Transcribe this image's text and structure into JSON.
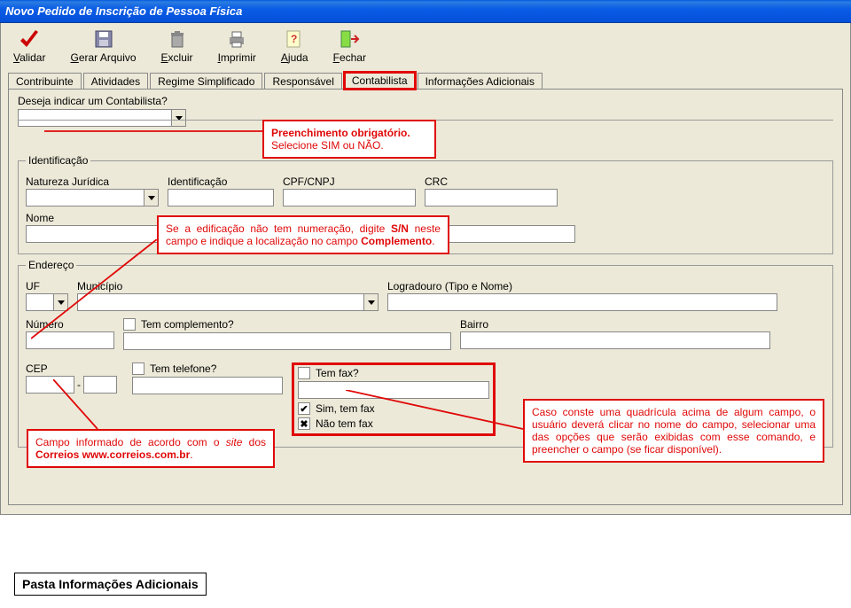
{
  "window": {
    "title": "Novo Pedido de Inscrição de Pessoa Física"
  },
  "toolbar": {
    "validar": "Validar",
    "gerar": "Gerar Arquivo",
    "excluir": "Excluir",
    "imprimir": "Imprimir",
    "ajuda": "Ajuda",
    "fechar": "Fechar"
  },
  "tabs": {
    "contribuinte": "Contribuinte",
    "atividades": "Atividades",
    "regime": "Regime Simplificado",
    "responsavel": "Responsável",
    "contabilista": "Contabilista",
    "infoadic": "Informações Adicionais"
  },
  "panel": {
    "desejalbl": "Deseja indicar um Contabilista?",
    "ident_legend": "Identificação",
    "nat_jur": "Natureza Jurídica",
    "ident": "Identificação",
    "cpfcnpj": "CPF/CNPJ",
    "crc": "CRC",
    "nome": "Nome",
    "end_legend": "Endereço",
    "uf": "UF",
    "municipio": "Município",
    "logradouro": "Logradouro (Tipo e Nome)",
    "numero": "Número",
    "temcomp": "Tem complemento?",
    "bairro": "Bairro",
    "cep": "CEP",
    "cepdash": "-",
    "temtel": "Tem telefone?",
    "temfax": "Tem fax?",
    "simfax": "Sim, tem fax",
    "naofax": "Não tem fax"
  },
  "callouts": {
    "c1": {
      "l1": "Preenchimento obrigatório.",
      "l2": "Selecione SIM ou NÃO."
    },
    "c2": {
      "pre": "Se a edificação não tem numeração, digite ",
      "bold": "S/N",
      "mid": " neste campo e indique a localização no campo ",
      "bold2": "Complemento",
      "end": "."
    },
    "c3": {
      "pre": "Campo informado de acordo com o ",
      "it": "site",
      "mid": " dos ",
      "b1": "Correios www.correios.com.br",
      "end": "."
    },
    "c4": "Caso conste uma quadrícula acima de algum campo, o usuário deverá clicar no nome do campo, selecionar uma das opções que serão exibidas com esse comando, e preencher o campo (se ficar disponível)."
  },
  "bottom": "Pasta Informações Adicionais",
  "chk": {
    "check": "✔",
    "x": "✖"
  }
}
